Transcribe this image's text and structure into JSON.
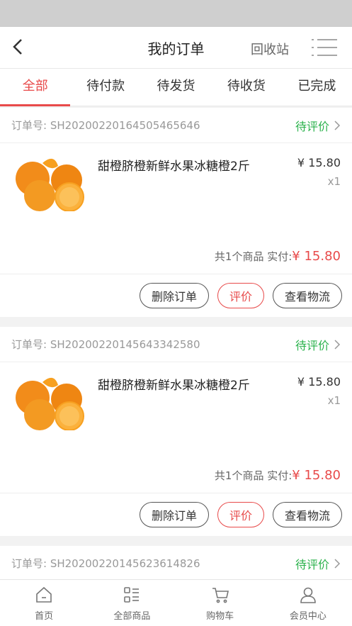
{
  "nav": {
    "title": "我的订单",
    "right_label": "回收站"
  },
  "tabs": [
    "全部",
    "待付款",
    "待发货",
    "待收货",
    "已完成"
  ],
  "orders": [
    {
      "order_no": "订单号: SH20200220164505465646",
      "status": "待评价",
      "item_name": "甜橙脐橙新鲜水果冰糖橙2斤",
      "price": "¥ 15.80",
      "qty": "x1",
      "summary_label": "共1个商品 实付:",
      "summary_amount": "¥ 15.80",
      "buttons": {
        "delete": "删除订单",
        "review": "评价",
        "logistics": "查看物流"
      }
    },
    {
      "order_no": "订单号: SH20200220145643342580",
      "status": "待评价",
      "item_name": "甜橙脐橙新鲜水果冰糖橙2斤",
      "price": "¥ 15.80",
      "qty": "x1",
      "summary_label": "共1个商品 实付:",
      "summary_amount": "¥ 15.80",
      "buttons": {
        "delete": "删除订单",
        "review": "评价",
        "logistics": "查看物流"
      }
    },
    {
      "order_no": "订单号: SH20200220145623614826",
      "status": "待评价"
    }
  ],
  "tabbar": [
    {
      "label": "首页",
      "icon": "home-icon"
    },
    {
      "label": "全部商品",
      "icon": "category-icon"
    },
    {
      "label": "购物车",
      "icon": "cart-icon"
    },
    {
      "label": "会员中心",
      "icon": "user-icon"
    }
  ],
  "colors": {
    "accent": "#e84a4a",
    "status_green": "#2bb24c"
  }
}
